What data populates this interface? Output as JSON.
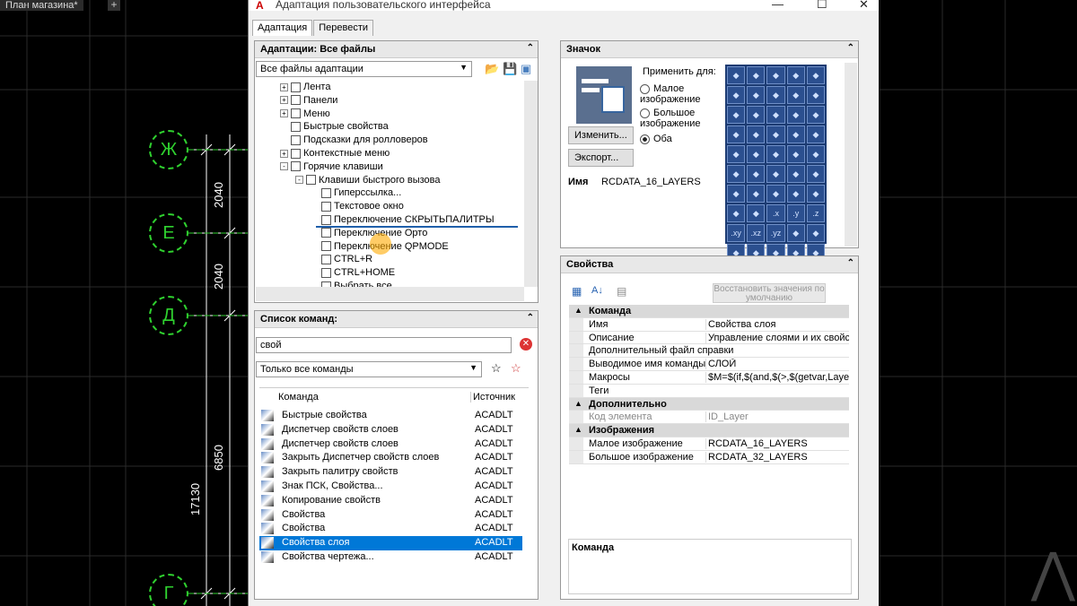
{
  "background_tab": "План магазина*",
  "axes": [
    "Ж",
    "Е",
    "Д",
    "Г"
  ],
  "dims": [
    "2040",
    "2040",
    "6850",
    "17130"
  ],
  "dialog": {
    "title": "Адаптация пользовательского интерфейса",
    "tabs": [
      "Адаптация",
      "Перевести"
    ]
  },
  "customizations": {
    "header": "Адаптации: Все файлы",
    "filter": "Все файлы адаптации",
    "tree": [
      {
        "label": "Лента",
        "exp": "+",
        "level": 1
      },
      {
        "label": "Панели",
        "exp": "+",
        "level": 1
      },
      {
        "label": "Меню",
        "exp": "+",
        "level": 1
      },
      {
        "label": "Быстрые свойства",
        "exp": "",
        "level": 1
      },
      {
        "label": "Подсказки для ролловеров",
        "exp": "",
        "level": 1
      },
      {
        "label": "Контекстные меню",
        "exp": "+",
        "level": 1
      },
      {
        "label": "Горячие клавиши",
        "exp": "-",
        "level": 1
      },
      {
        "label": "Клавиши быстрого вызова",
        "exp": "-",
        "level": 2
      },
      {
        "label": "Гиперссылка...",
        "exp": "",
        "level": 3
      },
      {
        "label": "Текстовое окно",
        "exp": "",
        "level": 3
      },
      {
        "label": "Переключение СКРЫТЬПАЛИТРЫ",
        "exp": "",
        "level": 3
      },
      {
        "label": "Переключение Орто",
        "exp": "",
        "level": 3
      },
      {
        "label": "Переключение QPMODE",
        "exp": "",
        "level": 3
      },
      {
        "label": "CTRL+R",
        "exp": "",
        "level": 3
      },
      {
        "label": "CTRL+HOME",
        "exp": "",
        "level": 3
      },
      {
        "label": "Выбрать все",
        "exp": "",
        "level": 3
      }
    ]
  },
  "commands": {
    "header": "Список команд:",
    "search_value": "свой",
    "filter": "Только все команды",
    "col_command": "Команда",
    "col_source": "Источник",
    "rows": [
      {
        "name": "Быстрые свойства",
        "src": "ACADLT"
      },
      {
        "name": "Диспетчер свойств слоев",
        "src": "ACADLT"
      },
      {
        "name": "Диспетчер свойств слоев",
        "src": "ACADLT"
      },
      {
        "name": "Закрыть Диспетчер свойств слоев",
        "src": "ACADLT"
      },
      {
        "name": "Закрыть палитру свойств",
        "src": "ACADLT"
      },
      {
        "name": "Знак ПСК, Свойства...",
        "src": "ACADLT"
      },
      {
        "name": "Копирование свойств",
        "src": "ACADLT"
      },
      {
        "name": "Свойства",
        "src": "ACADLT"
      },
      {
        "name": "Свойства",
        "src": "ACADLT"
      },
      {
        "name": "Свойства слоя",
        "src": "ACADLT",
        "selected": true
      },
      {
        "name": "Свойства чертежа...",
        "src": "ACADLT"
      }
    ]
  },
  "icon_panel": {
    "header": "Значок",
    "apply_for": "Применить для:",
    "opt_small": "Малое изображение",
    "opt_large": "Большое изображение",
    "opt_both": "Оба",
    "edit_btn": "Изменить...",
    "export_btn": "Экспорт...",
    "name_label": "Имя",
    "name_value": "RCDATA_16_LAYERS",
    "grid_labels": [
      ".x",
      ".y",
      ".z",
      ".xy",
      ".xz",
      ".yz"
    ]
  },
  "properties": {
    "header": "Свойства",
    "restore_btn": "Восстановить значения по умолчанию",
    "rows": [
      {
        "cat": true,
        "k": "Команда"
      },
      {
        "k": "Имя",
        "v": "Свойства слоя"
      },
      {
        "k": "Описание",
        "v": "Управление слоями и их свойства"
      },
      {
        "k": "Дополнительный файл справки",
        "v": ""
      },
      {
        "k": "Выводимое имя команды",
        "v": "СЛОЙ"
      },
      {
        "k": "Макросы",
        "v": "$M=$(if,$(and,$(>,$(getvar,LayerMan"
      },
      {
        "k": "Теги",
        "v": ""
      },
      {
        "cat": true,
        "k": "Дополнительно"
      },
      {
        "k": "Код элемента",
        "v": "ID_Layer",
        "grey": true
      },
      {
        "cat": true,
        "k": "Изображения"
      },
      {
        "k": "Малое изображение",
        "v": "RCDATA_16_LAYERS"
      },
      {
        "k": "Большое изображение",
        "v": "RCDATA_32_LAYERS"
      }
    ],
    "desc_title": "Команда"
  }
}
